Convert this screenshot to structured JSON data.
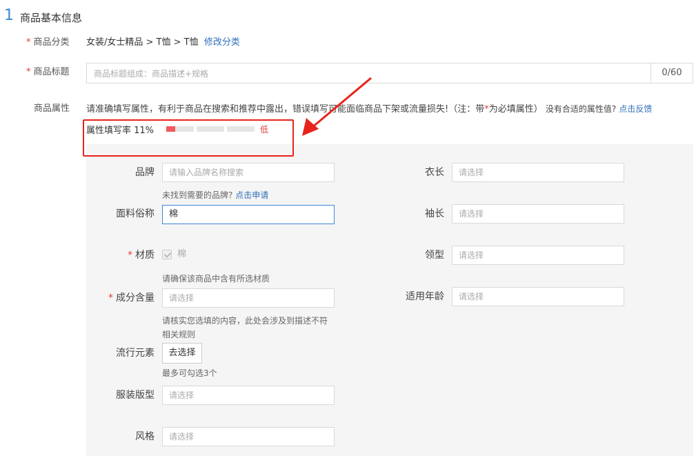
{
  "section": {
    "number": "1",
    "title": "商品基本信息"
  },
  "category": {
    "label": "商品分类",
    "required_mark": "*",
    "path": "女装/女士精品 > T恤 > T恤",
    "edit_link": "修改分类"
  },
  "product_title": {
    "label": "商品标题",
    "required_mark": "*",
    "placeholder": "商品标题组成：商品描述+规格",
    "counter": "0/60"
  },
  "attributes": {
    "label": "商品属性",
    "hint_part1": "请准确填写属性，有利于商品在搜索和推荐中露出，错误填写可能面临商品下架或流量损失!（注：带",
    "hint_star": "*",
    "hint_part2": "为必填属性）",
    "no_match": "没有合适的属性值?",
    "feedback_link": "点击反馈",
    "fill_rate_label": "属性填写率 11%",
    "fill_rate_value": 0.11,
    "fill_level": "低"
  },
  "fields": {
    "brand": {
      "label": "品牌",
      "placeholder": "请输入品牌名称搜索",
      "hint": "未找到需要的品牌?",
      "hint_link": "点击申请"
    },
    "fabric": {
      "label": "面料俗称",
      "value": "棉"
    },
    "material": {
      "label": "材质",
      "required_mark": "*",
      "option": "棉",
      "hint": "请确保该商品中含有所选材质"
    },
    "composition": {
      "label": "成分含量",
      "required_mark": "*",
      "placeholder": "请选择",
      "hint_line1": "请核实您选填的内容，此处会涉及到描述不符",
      "hint_line2": "相关规则"
    },
    "trend": {
      "label": "流行元素",
      "button": "去选择",
      "hint": "最多可勾选3个"
    },
    "fit": {
      "label": "服装版型",
      "placeholder": "请选择"
    },
    "style": {
      "label": "风格",
      "placeholder": "请选择"
    },
    "length": {
      "label": "衣长",
      "placeholder": "请选择"
    },
    "sleeve": {
      "label": "袖长",
      "placeholder": "请选择"
    },
    "collar": {
      "label": "领型",
      "placeholder": "请选择"
    },
    "age": {
      "label": "适用年龄",
      "placeholder": "请选择"
    }
  },
  "colors": {
    "accent": "#3a86d6",
    "required": "#e4393c",
    "annotation": "#e8231a",
    "bar_fill": "#f15b5b"
  }
}
